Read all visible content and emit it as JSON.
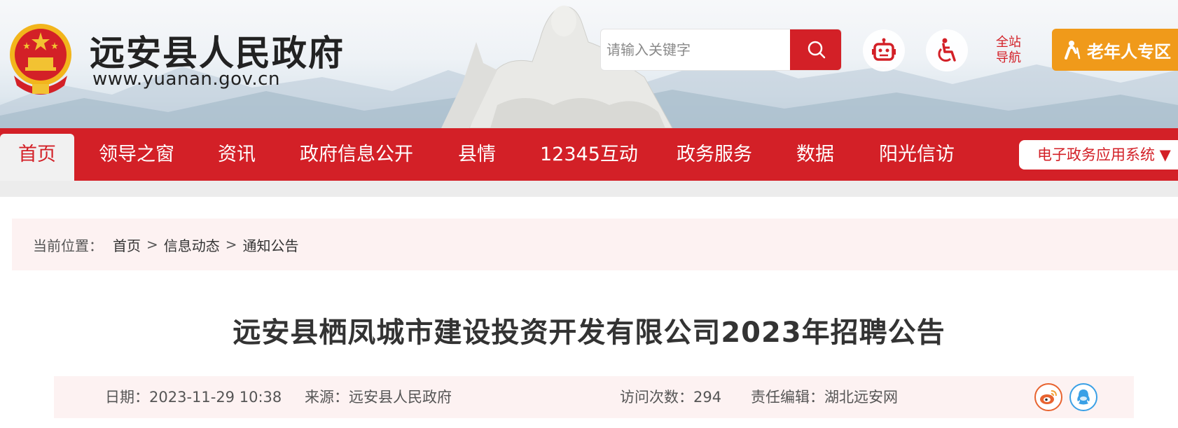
{
  "header": {
    "site_title": "远安县人民政府",
    "site_url": "www.yuanan.gov.cn",
    "search_placeholder": "请输入关键字",
    "sitemap_line1": "全站",
    "sitemap_line2": "导航",
    "elder_zone_label": "老年人专区",
    "accent_color": "#d32027",
    "elder_color": "#f09a1a"
  },
  "nav": {
    "items": [
      "首页",
      "领导之窗",
      "资讯",
      "政府信息公开",
      "县情",
      "12345互动",
      "政务服务",
      "数据",
      "阳光信访"
    ],
    "active_index": 0,
    "dropdown_label": "电子政务应用系统 ▼"
  },
  "breadcrumb": {
    "label": "当前位置：",
    "items": [
      "首页",
      "信息动态",
      "通知公告"
    ],
    "separator": ">"
  },
  "article": {
    "title": "远安县栖凤城市建设投资开发有限公司2023年招聘公告",
    "date_label": "日期：",
    "date_value": "2023-11-29 10:38",
    "source_label": "来源：",
    "source_value": "远安县人民政府",
    "visits_label": "访问次数：",
    "visits_value": "294",
    "editor_label": "责任编辑：",
    "editor_value": "湖北远安网"
  },
  "icons": {
    "search": "search-icon",
    "robot": "robot-icon",
    "accessibility": "wheelchair-icon",
    "elder": "elder-person-icon",
    "weibo": "weibo-icon",
    "qq": "qq-icon"
  }
}
